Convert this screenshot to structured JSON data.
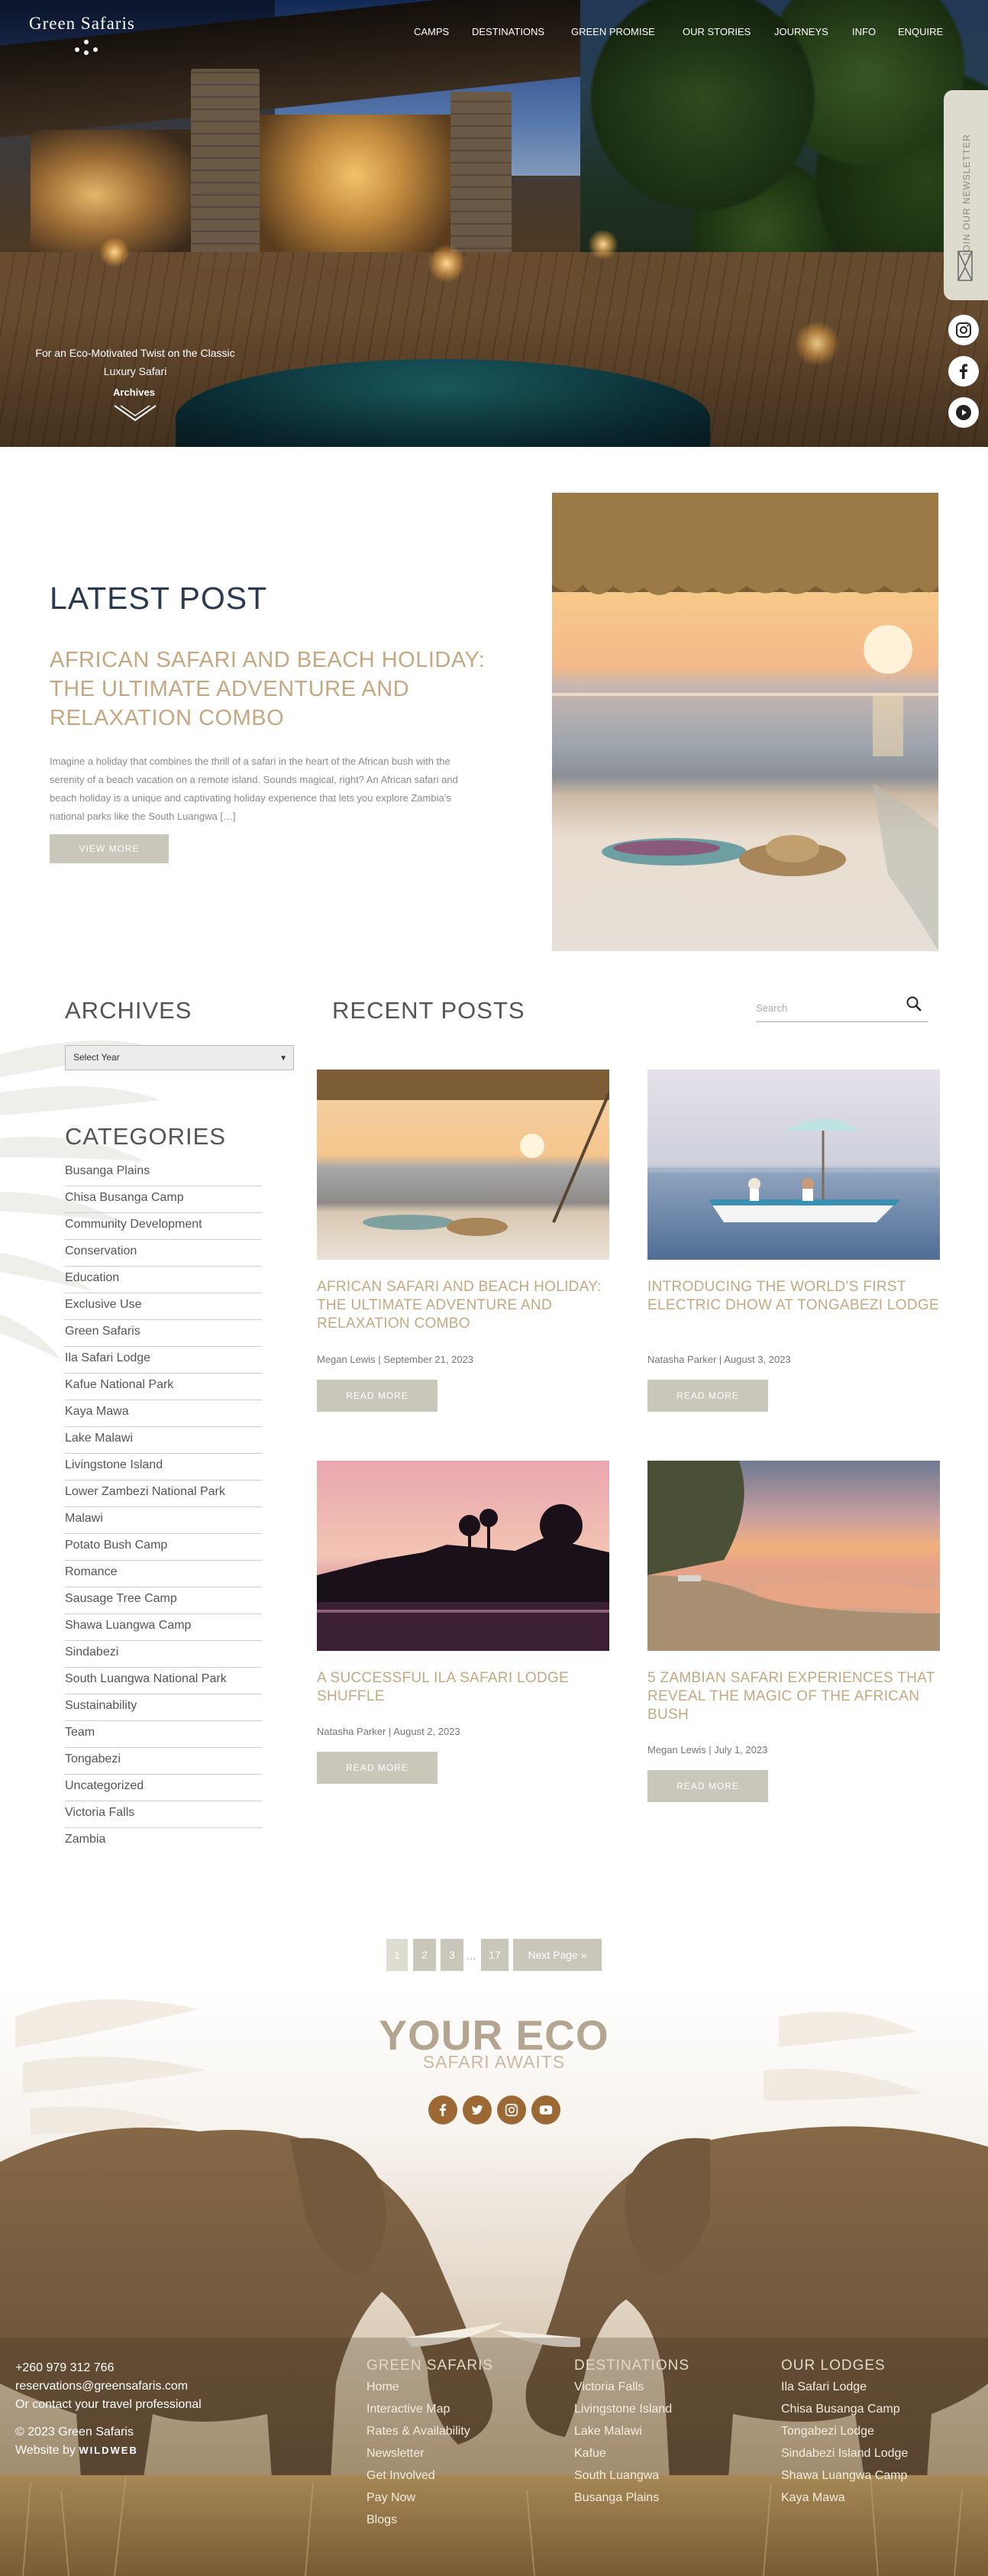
{
  "brand": {
    "name": "Green Safaris"
  },
  "nav": {
    "items": [
      "CAMPS",
      "DESTINATIONS",
      "GREEN PROMISE",
      "OUR STORIES",
      "JOURNEYS",
      "INFO",
      "ENQUIRE"
    ]
  },
  "hero": {
    "tagline_1": "For an Eco-Motivated Twist on the Classic",
    "tagline_2": "Luxury Safari",
    "archives_label": "Archives"
  },
  "newsletter": {
    "label": "JOIN OUR NEWSLETTER"
  },
  "social_icons": [
    "instagram-icon",
    "facebook-icon",
    "youtube-icon"
  ],
  "latest_post": {
    "heading": "LATEST POST",
    "title": "AFRICAN SAFARI AND BEACH HOLIDAY: THE ULTIMATE ADVENTURE AND RELAXATION COMBO",
    "excerpt": "Imagine a holiday that combines the thrill of a safari in the heart of the African bush with the serenity of a beach vacation on a remote island. Sounds magical, right? An African safari and beach holiday is a unique and captivating holiday experience that lets you explore Zambia’s national parks like the South Luangwa […]",
    "button": "VIEW MORE"
  },
  "sidebar": {
    "archives_heading": "ARCHIVES",
    "select_value": "Select Year",
    "categories_heading": "CATEGORIES",
    "categories": [
      "Busanga Plains",
      "Chisa Busanga Camp",
      "Community Development",
      "Conservation",
      "Education",
      "Exclusive Use",
      "Green Safaris",
      "Ila Safari Lodge",
      "Kafue National Park",
      "Kaya Mawa",
      "Lake Malawi",
      "Livingstone Island",
      "Lower Zambezi National Park",
      "Malawi",
      "Potato Bush Camp",
      "Romance",
      "Sausage Tree Camp",
      "Shawa Luangwa Camp",
      "Sindabezi",
      "South Luangwa National Park",
      "Sustainability",
      "Team",
      "Tongabezi",
      "Uncategorized",
      "Victoria Falls",
      "Zambia"
    ]
  },
  "recent": {
    "heading": "RECENT POSTS",
    "search_placeholder": "Search",
    "posts": [
      {
        "title": "AFRICAN SAFARI AND BEACH HOLIDAY: THE ULTIMATE ADVENTURE AND RELAXATION COMBO",
        "meta": "Megan Lewis | September 21, 2023",
        "button": "READ MORE"
      },
      {
        "title": "INTRODUCING THE WORLD’S FIRST ELECTRIC DHOW AT TONGABEZI LODGE",
        "meta": "Natasha Parker | August 3, 2023",
        "button": "READ MORE"
      },
      {
        "title": "A SUCCESSFUL ILA SAFARI LODGE SHUFFLE",
        "meta": "Natasha Parker | August 2, 2023",
        "button": "READ MORE"
      },
      {
        "title": "5 ZAMBIAN SAFARI EXPERIENCES THAT REVEAL THE MAGIC OF THE AFRICAN BUSH",
        "meta": "Megan Lewis | July 1, 2023",
        "button": "READ MORE"
      }
    ]
  },
  "pagination": {
    "pages": [
      "1",
      "2",
      "3"
    ],
    "dots": "…",
    "last": "17",
    "next": "Next Page »"
  },
  "footer": {
    "eco_big": "YOUR ECO",
    "eco_small": "SAFARI AWAITS",
    "social_icons": [
      "facebook-icon",
      "twitter-icon",
      "instagram-icon",
      "youtube-icon"
    ],
    "contact": {
      "phone": "+260 979 312 766",
      "email": "reservations@greensafaris.com",
      "or": "Or contact your travel professional",
      "copyright": "© 2023 Green Safaris",
      "website_by": "Website by",
      "agency": "WILDWEB"
    },
    "columns": [
      {
        "heading": "GREEN SAFARIS",
        "links": [
          "Home",
          "Interactive Map",
          "Rates & Availability",
          "Newsletter",
          "Get Involved",
          "Pay Now",
          "Blogs"
        ]
      },
      {
        "heading": "DESTINATIONS",
        "links": [
          "Victoria Falls",
          "Livingstone Island",
          "Lake Malawi",
          "Kafue",
          "South Luangwa",
          "Busanga Plains"
        ]
      },
      {
        "heading": "OUR LODGES",
        "links": [
          "Ila Safari Lodge",
          "Chisa Busanga Camp",
          "Tongabezi Lodge",
          "Sindabezi Island Lodge",
          "Shawa Luangwa Camp",
          "Kaya Mawa"
        ]
      }
    ]
  }
}
